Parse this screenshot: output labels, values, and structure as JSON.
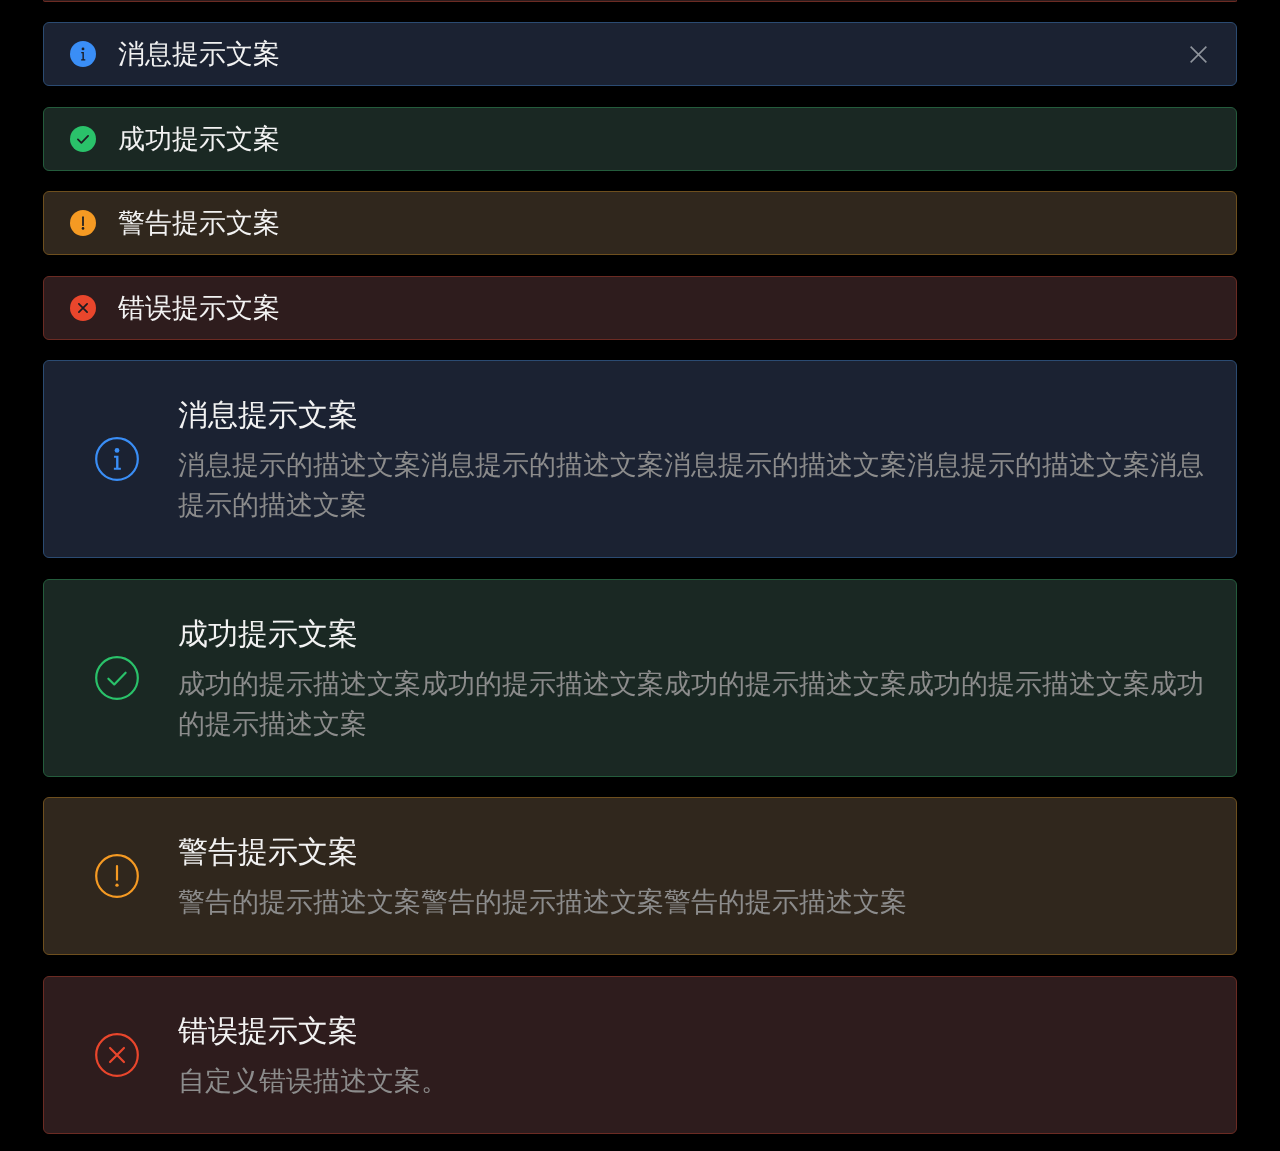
{
  "clipped_alert": {
    "kind": "error"
  },
  "simple_alerts": [
    {
      "kind": "info",
      "title": "消息提示文案",
      "closable": true
    },
    {
      "kind": "success",
      "title": "成功提示文案",
      "closable": false
    },
    {
      "kind": "warning",
      "title": "警告提示文案",
      "closable": false
    },
    {
      "kind": "error",
      "title": "错误提示文案",
      "closable": false
    }
  ],
  "detailed_alerts": [
    {
      "kind": "info",
      "title": "消息提示文案",
      "description": "消息提示的描述文案消息提示的描述文案消息提示的描述文案消息提示的描述文案消息提示的描述文案"
    },
    {
      "kind": "success",
      "title": "成功提示文案",
      "description": "成功的提示描述文案成功的提示描述文案成功的提示描述文案成功的提示描述文案成功的提示描述文案"
    },
    {
      "kind": "warning",
      "title": "警告提示文案",
      "description": "警告的提示描述文案警告的提示描述文案警告的提示描述文案"
    },
    {
      "kind": "error",
      "title": "错误提示文案",
      "description": "自定义错误描述文案。"
    }
  ]
}
